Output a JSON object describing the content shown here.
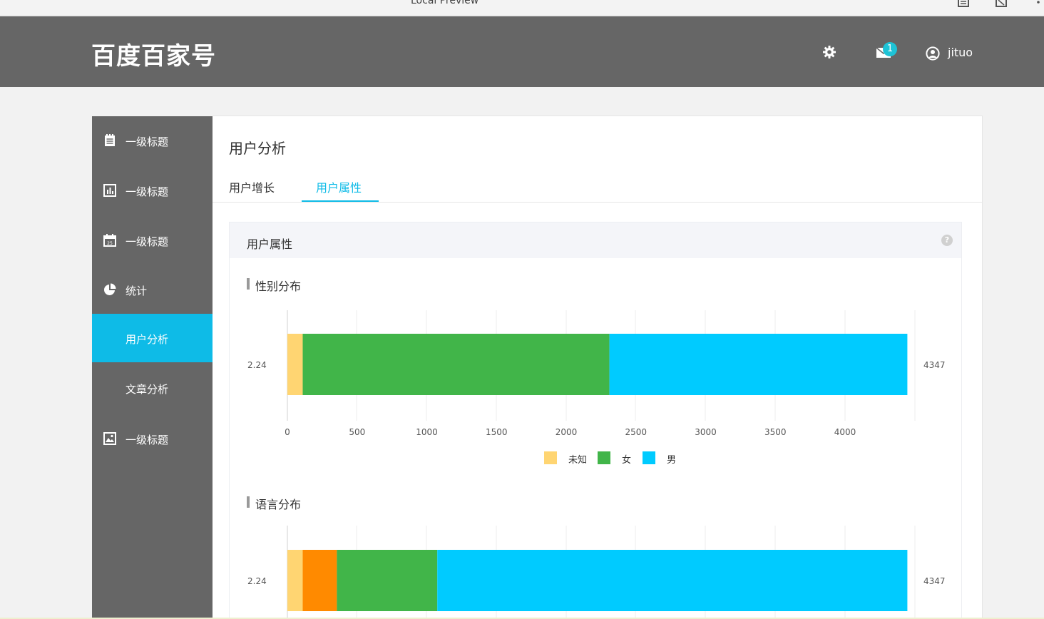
{
  "browser": {
    "title": "Local Preview"
  },
  "header": {
    "logo": "百度百家号",
    "mail_count": "1",
    "username": "jituo"
  },
  "sidebar": {
    "items": [
      {
        "label": "一级标题",
        "icon": "notepad-icon"
      },
      {
        "label": "一级标题",
        "icon": "bar-chart-icon"
      },
      {
        "label": "一级标题",
        "icon": "calendar-icon"
      },
      {
        "label": "统计",
        "icon": "pie-chart-icon"
      },
      {
        "label": "用户分析",
        "icon": "",
        "active": true
      },
      {
        "label": "文章分析",
        "icon": ""
      },
      {
        "label": "一级标题",
        "icon": "image-icon"
      }
    ]
  },
  "main": {
    "title": "用户分析",
    "tabs": [
      {
        "label": "用户增长"
      },
      {
        "label": "用户属性",
        "active": true
      }
    ],
    "card_title": "用户属性",
    "help": "?",
    "accent": "#0ebbe7",
    "sections": [
      {
        "title": "性别分布"
      },
      {
        "title": "语言分布"
      }
    ]
  },
  "chart_data": [
    {
      "type": "bar",
      "orientation": "horizontal",
      "stacked": true,
      "title": "性别分布",
      "categories": [
        "2.24"
      ],
      "right_label": "4347",
      "xlim": [
        0,
        4500
      ],
      "x_ticks": [
        "0",
        "500",
        "1000",
        "1500",
        "2000",
        "2500",
        "3000",
        "3500",
        "4000"
      ],
      "grid": true,
      "legend_position": "bottom",
      "series": [
        {
          "name": "未知",
          "color": "#ffd572",
          "values": [
            110
          ]
        },
        {
          "name": "女",
          "color": "#41b549",
          "values": [
            2200
          ]
        },
        {
          "name": "男",
          "color": "#00cbff",
          "values": [
            2137
          ]
        }
      ]
    },
    {
      "type": "bar",
      "orientation": "horizontal",
      "stacked": true,
      "title": "语言分布",
      "categories": [
        "2.24"
      ],
      "right_label": "4347",
      "xlim": [
        0,
        4500
      ],
      "grid": true,
      "series": [
        {
          "color": "#ffd572",
          "values": [
            110
          ]
        },
        {
          "color": "#ff8a00",
          "values": [
            245
          ]
        },
        {
          "color": "#41b549",
          "values": [
            720
          ]
        },
        {
          "color": "#00cbff",
          "values": [
            3372
          ]
        }
      ]
    }
  ]
}
